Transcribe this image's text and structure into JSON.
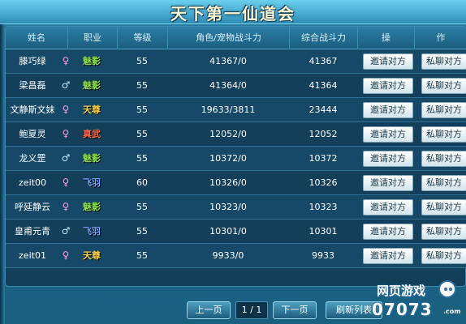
{
  "title": "天下第一仙道会",
  "headers": {
    "name": "姓名",
    "job": "职业",
    "level": "等级",
    "power": "角色/宠物战斗力",
    "total": "综合战斗力",
    "op1": "操",
    "op2": "作"
  },
  "rows": [
    {
      "name": "滕巧绿",
      "gender": "♀",
      "job": "魅影",
      "level": "55",
      "power": "41367/0",
      "total": "41367",
      "invite": "邀请对方",
      "chat": "私聊对方"
    },
    {
      "name": "梁昌磊",
      "gender": "♂",
      "job": "魅影",
      "level": "55",
      "power": "41364/0",
      "total": "41364",
      "invite": "邀请对方",
      "chat": "私聊对方"
    },
    {
      "name": "文静斯文妹",
      "gender": "♀",
      "job": "天尊",
      "level": "55",
      "power": "19633/3811",
      "total": "23444",
      "invite": "邀请对方",
      "chat": "私聊对方"
    },
    {
      "name": "鲍夏灵",
      "gender": "♀",
      "job": "真武",
      "level": "55",
      "power": "12052/0",
      "total": "12052",
      "invite": "邀请对方",
      "chat": "私聊对方"
    },
    {
      "name": "龙义罡",
      "gender": "♂",
      "job": "魅影",
      "level": "55",
      "power": "10372/0",
      "total": "10372",
      "invite": "邀请对方",
      "chat": "私聊对方"
    },
    {
      "name": "zeit00",
      "gender": "♀",
      "job": "飞羽",
      "level": "60",
      "power": "10326/0",
      "total": "10326",
      "invite": "邀请对方",
      "chat": "私聊对方"
    },
    {
      "name": "呼延静云",
      "gender": "♀",
      "job": "魅影",
      "level": "55",
      "power": "10323/0",
      "total": "10323",
      "invite": "邀请对方",
      "chat": "私聊对方"
    },
    {
      "name": "皇甫元青",
      "gender": "♂",
      "job": "飞羽",
      "level": "55",
      "power": "10301/0",
      "total": "10301",
      "invite": "邀请对方",
      "chat": "私聊对方"
    },
    {
      "name": "zeit01",
      "gender": "♀",
      "job": "天尊",
      "level": "55",
      "power": "9933/0",
      "total": "9933",
      "invite": "邀请对方",
      "chat": "私聊对方"
    }
  ],
  "job_colors": {
    "魅影": "#8fe04a",
    "天尊": "#ffd23a",
    "真武": "#ff6a4a",
    "飞羽": "#6fa0ff"
  },
  "footer": {
    "prev": "上一页",
    "page": "1 / 1",
    "next": "下一页",
    "refresh": "刷新列表"
  },
  "watermark": {
    "line1": "网页游戏",
    "line2": "07073",
    "suffix": ".com",
    "mascot_icon": "mascot-icon"
  }
}
